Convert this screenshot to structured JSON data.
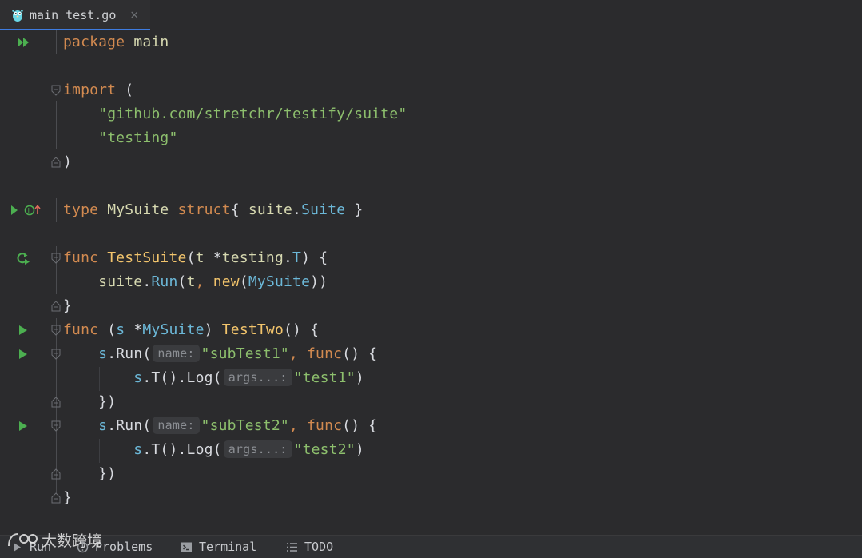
{
  "tab": {
    "title": "main_test.go",
    "close": "×",
    "icon": "gopher-icon"
  },
  "code": {
    "l1": {
      "kw": "package",
      "name": "main"
    },
    "l3": {
      "kw": "import",
      "paren": "("
    },
    "l4": {
      "str": "\"github.com/stretchr/testify/suite\""
    },
    "l5": {
      "str": "\"testing\""
    },
    "l6": {
      "paren": ")"
    },
    "l8": {
      "kw": "type",
      "name": "MySuite",
      "kw2": "struct",
      "open": "{",
      "pkg": "suite",
      "dot": ".",
      "typ": "Suite",
      "close": "}"
    },
    "l10": {
      "kw": "func",
      "name": "TestSuite",
      "open": "(",
      "param": "t",
      "star": "*",
      "pkg": "testing",
      "dot": ".",
      "typ": "T",
      "close": ")",
      "brace": "{"
    },
    "l11": {
      "pkg": "suite",
      "dot": ".",
      "fn": "Run",
      "open": "(",
      "arg": "t",
      "comma": ",",
      "kw": "new",
      "open2": "(",
      "typ": "MySuite",
      "close": "))"
    },
    "l12": {
      "brace": "}"
    },
    "l13": {
      "kw": "func",
      "open": "(",
      "recv": "s",
      "star": "*",
      "typ": "MySuite",
      "close": ")",
      "name": "TestTwo",
      "parens": "()",
      "brace": "{"
    },
    "l14": {
      "recv": "s",
      "fn": ".Run(",
      "hint": "name:",
      "str": "\"subTest1\"",
      "comma": ",",
      "kw": "func",
      "rest": "() {"
    },
    "l15": {
      "recv": "s",
      "fn": ".T().Log(",
      "hint": "args...:",
      "str": "\"test1\"",
      "close": ")"
    },
    "l16": {
      "text": "})"
    },
    "l17": {
      "recv": "s",
      "fn": ".Run(",
      "hint": "name:",
      "str": "\"subTest2\"",
      "comma": ",",
      "kw": "func",
      "rest": "() {"
    },
    "l18": {
      "recv": "s",
      "fn": ".T().Log(",
      "hint": "args...:",
      "str": "\"test2\"",
      "close": ")"
    },
    "l19": {
      "text": "})"
    },
    "l20": {
      "text": "}"
    }
  },
  "statusbar": {
    "run": "Run",
    "problems": "Problems",
    "terminal": "Terminal",
    "todo": "TODO"
  },
  "watermark": {
    "text": "大数跨境"
  },
  "colors": {
    "background": "#2b2b2d",
    "keyword": "#d28a50",
    "string": "#8dbf6d",
    "function": "#f2c46c",
    "type": "#6cb8d8",
    "run_green": "#4caf50",
    "tab_accent": "#3e7ce0"
  }
}
